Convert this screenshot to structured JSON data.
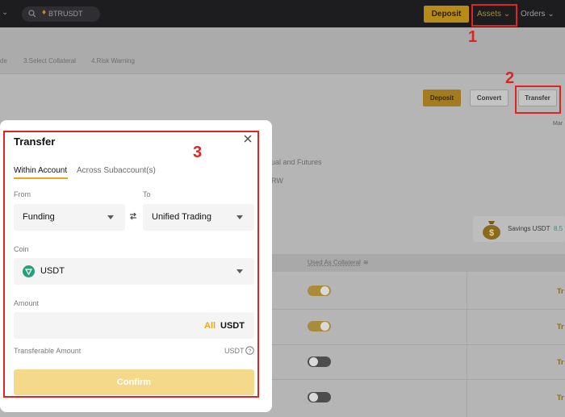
{
  "nav": {
    "search_text": "BTRUSDT",
    "deposit_label": "Deposit",
    "assets_label": "Assets",
    "orders_label": "Orders"
  },
  "steps": [
    {
      "label": "de"
    },
    {
      "label": "3.Select Collateral"
    },
    {
      "label": "4.Risk Warning"
    }
  ],
  "page_buttons": {
    "deposit": "Deposit",
    "convert": "Convert",
    "transfer": "Transfer"
  },
  "background": {
    "ma_label": "Mar",
    "text1": "ual and Futures",
    "text2": "RW",
    "savings_label": "Savings USDT",
    "savings_value": "8.5",
    "used_as_collateral": "Used As Collateral",
    "row_link": "Tr"
  },
  "annotations": {
    "n1": "1",
    "n2": "2",
    "n3": "3"
  },
  "modal": {
    "title": "Transfer",
    "tabs": [
      "Within Account",
      "Across Subaccount(s)"
    ],
    "from_label": "From",
    "to_label": "To",
    "from_value": "Funding",
    "to_value": "Unified Trading",
    "coin_label": "Coin",
    "coin_value": "USDT",
    "amount_label": "Amount",
    "amount_all": "All",
    "amount_unit": "USDT",
    "transferable_label": "Transferable Amount",
    "transferable_unit": "USDT",
    "confirm_label": "Confirm"
  },
  "colors": {
    "accent": "#e9a915",
    "annotation": "#e02424",
    "usdt_icon": "#26a17b"
  }
}
